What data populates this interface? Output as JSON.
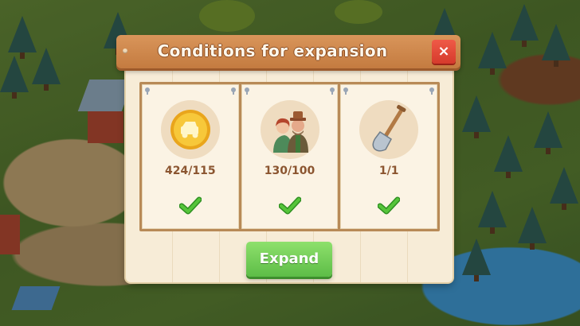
{
  "dialog": {
    "title": "Conditions for expansion",
    "close_label": "×",
    "conditions": [
      {
        "icon": "coin-icon",
        "value": "424/115",
        "met": true
      },
      {
        "icon": "farmers-icon",
        "value": "130/100",
        "met": true
      },
      {
        "icon": "shovel-icon",
        "value": "1/1",
        "met": true
      }
    ],
    "expand_label": "Expand"
  },
  "colors": {
    "title_bar": "#c47b40",
    "close_button": "#d63a2c",
    "expand_button": "#5dbd47",
    "check": "#3fae2c",
    "value_text": "#8b5530"
  }
}
